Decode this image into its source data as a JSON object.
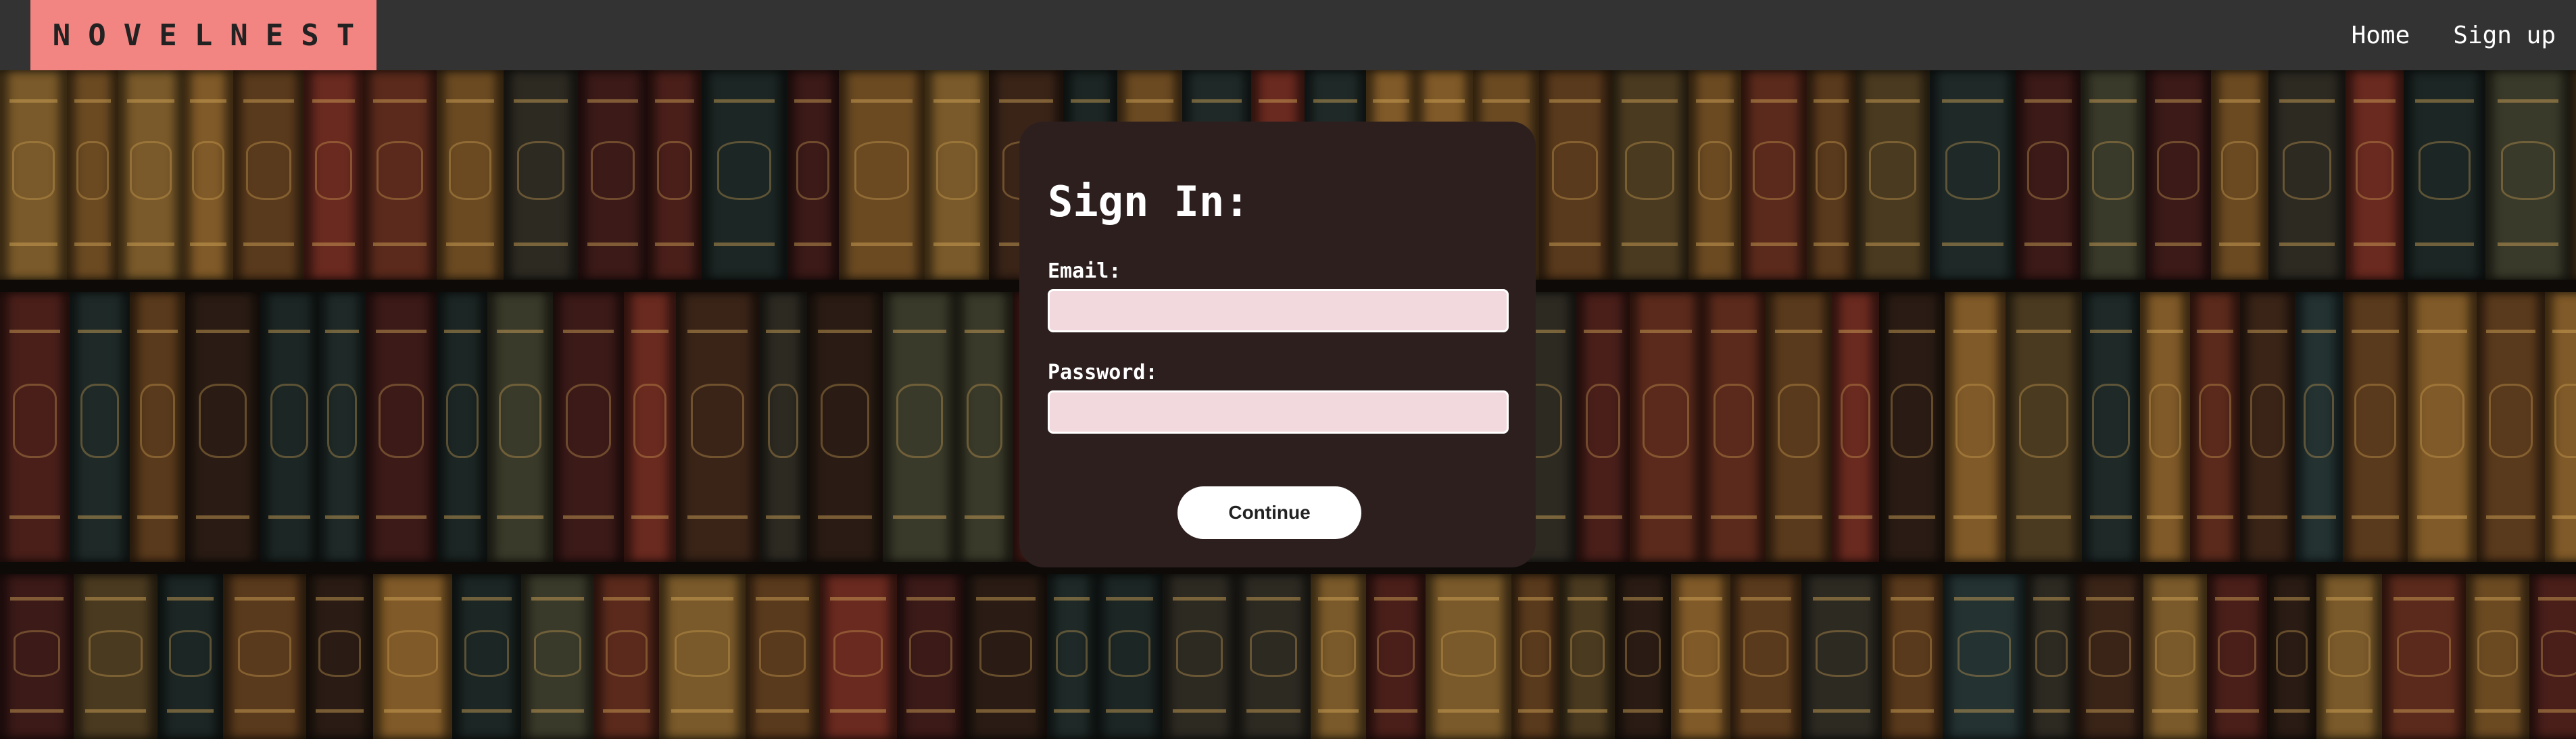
{
  "brand": {
    "name": "NOVELNEST",
    "accent_color": "#f28482"
  },
  "nav": {
    "items": [
      {
        "label": "Home"
      },
      {
        "label": "Sign up"
      }
    ]
  },
  "signin": {
    "title": "Sign In:",
    "email_label": "Email:",
    "email_value": "",
    "password_label": "Password:",
    "password_value": "",
    "submit_label": "Continue"
  },
  "background": {
    "description_icon": "bookshelf-background",
    "card_color": "#2e1f1f",
    "input_color": "#f2d9dd"
  }
}
